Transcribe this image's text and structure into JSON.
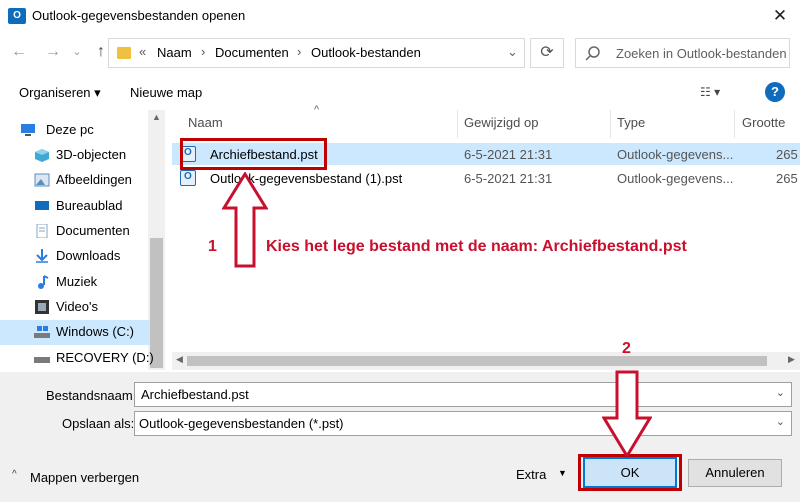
{
  "window": {
    "title": "Outlook-gegevensbestanden openen",
    "app_icon": "O",
    "close": "✕"
  },
  "nav": {
    "back": "←",
    "forward": "→",
    "dropdown": "⌄",
    "up": "↑",
    "refresh": "⟳"
  },
  "address": {
    "chevrons": "«",
    "crumbs": [
      "Naam",
      "Documenten",
      "Outlook-bestanden"
    ],
    "dropdown": "⌄"
  },
  "search": {
    "placeholder": "Zoeken in Outlook-bestanden",
    "icon": "search-icon"
  },
  "toolbar": {
    "organise": "Organiseren ▾",
    "new_folder": "Nieuwe map",
    "view": "☷ ▾",
    "help": "?"
  },
  "sidebar": {
    "items": [
      {
        "label": "Deze pc",
        "icon": "computer-icon",
        "color": "#2a7de1"
      },
      {
        "label": "3D-objecten",
        "icon": "cube-icon",
        "color": "#3fa9d6"
      },
      {
        "label": "Afbeeldingen",
        "icon": "image-icon",
        "color": "#5a8fbf"
      },
      {
        "label": "Bureaublad",
        "icon": "desktop-icon",
        "color": "#0f6cbd"
      },
      {
        "label": "Documenten",
        "icon": "document-icon",
        "color": "#8aa4c0"
      },
      {
        "label": "Downloads",
        "icon": "download-icon",
        "color": "#2a7de1"
      },
      {
        "label": "Muziek",
        "icon": "music-icon",
        "color": "#2a7de1"
      },
      {
        "label": "Video's",
        "icon": "film-icon",
        "color": "#333333"
      },
      {
        "label": "Windows (C:)",
        "icon": "drive-icon",
        "color": "#7a7a7a"
      },
      {
        "label": "RECOVERY (D:)",
        "icon": "drive-icon",
        "color": "#7a7a7a"
      }
    ],
    "selected_index": 8
  },
  "columns": {
    "name": "Naam",
    "modified": "Gewijzigd op",
    "type": "Type",
    "size": "Grootte",
    "sort_arrow": "^"
  },
  "files": [
    {
      "name": "Archiefbestand.pst",
      "modified": "6-5-2021 21:31",
      "type": "Outlook-gegevens...",
      "size": "265"
    },
    {
      "name": "Outlook-gegevensbestand (1).pst",
      "modified": "6-5-2021 21:31",
      "type": "Outlook-gegevens...",
      "size": "265"
    }
  ],
  "form": {
    "filename_label": "Bestandsnaam:",
    "filename_value": "Archiefbestand.pst",
    "filetype_label": "Opslaan als:",
    "filetype_value": "Outlook-gegevensbestanden (*.pst)"
  },
  "footer": {
    "hide_folders": "Mappen verbergen",
    "hide_icon": "^",
    "extra": "Extra",
    "extra_caret": "▼",
    "ok": "OK",
    "cancel": "Annuleren"
  },
  "annotations": {
    "step1_number": "1",
    "step1_text": "Kies het lege bestand met de naam:  Archiefbestand.pst",
    "step2_number": "2",
    "color": "#c8102e"
  }
}
